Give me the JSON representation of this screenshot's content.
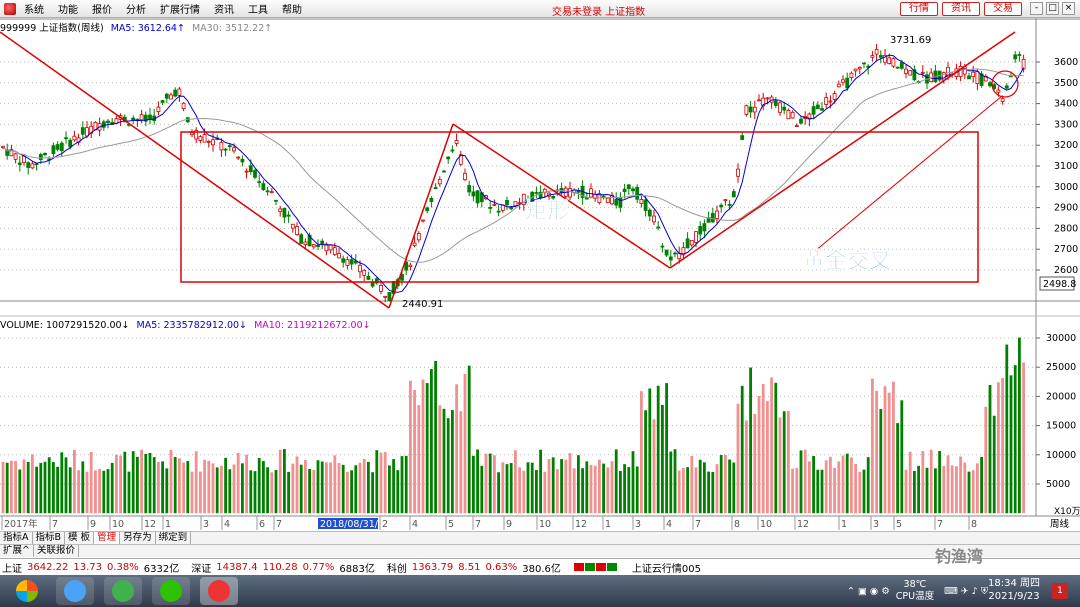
{
  "menubar": {
    "items": [
      "系统",
      "功能",
      "报价",
      "分析",
      "扩展行情",
      "资讯",
      "工具",
      "帮助"
    ],
    "center_title": "交易未登录 上证指数",
    "buttons": [
      "行情",
      "资讯",
      "交易"
    ],
    "window_controls": [
      "-",
      "□",
      "×"
    ]
  },
  "price_panel": {
    "code_name": "999999 上证指数(周线)",
    "ma5_label": "MA5: 3612.64↑",
    "ma30_label": "MA30: 3512.22↑",
    "current_price_tag": "2498.8",
    "high_label": "3731.69",
    "low_label": "2440.91",
    "annotation_rect": "矩形",
    "annotation_cross": "黄金交叉",
    "y_ticks": [
      "3600",
      "3500",
      "3400",
      "3300",
      "3200",
      "3100",
      "3000",
      "2900",
      "2800",
      "2700",
      "2600"
    ]
  },
  "volume_panel": {
    "volume_label": "VOLUME: 1007291520.00↓",
    "ma5_label": "MA5: 2335782912.00↓",
    "ma10_label": "MA10: 2119212672.00↓",
    "y_ticks": [
      "30000",
      "25000",
      "20000",
      "15000",
      "10000",
      "5000"
    ],
    "unit_label": "X10万"
  },
  "x_axis": {
    "labels": [
      "2017年",
      "7",
      "9",
      "10",
      "12",
      "1",
      "3",
      "4",
      "6",
      "7",
      "2018/08/31/五",
      "2",
      "4",
      "5",
      "7",
      "9",
      "10",
      "12",
      "1",
      "3",
      "4",
      "7",
      "8",
      "10",
      "12",
      "1",
      "3",
      "5",
      "7",
      "8"
    ],
    "period_label": "周线"
  },
  "bottom_tabs": [
    "指标A",
    "指标B",
    "模 板",
    "管理",
    "另存为",
    "绑定到"
  ],
  "active_tab": "管理",
  "sub_tabs": [
    "扩展^",
    "关联报价"
  ],
  "ticker": {
    "sh_label": "上证",
    "sh_price": "3642.22",
    "sh_change": "13.73",
    "sh_pct": "0.38%",
    "sh_amount": "6332亿",
    "sz_label": "深证",
    "sz_price": "14387.4",
    "sz_change": "110.28",
    "sz_pct": "0.77%",
    "sz_amount": "6883亿",
    "kc_label": "科创",
    "kc_price": "1363.79",
    "kc_change": "8.51",
    "kc_pct": "0.63%",
    "kc_amount": "380.6亿",
    "cloud_label": "上证云行情005"
  },
  "taskbar": {
    "temp": "38℃",
    "cpu_label": "CPU温度",
    "time": "18:34 周四",
    "date": "2021/9/23",
    "notification_count": "1"
  },
  "watermark": "钓渔湾",
  "colors": {
    "up": "#d00000",
    "down": "#008000",
    "ma5": "#0000cc",
    "ma30": "#999999",
    "ma10_vol": "#cc00cc",
    "trendline": "#e00000"
  }
}
